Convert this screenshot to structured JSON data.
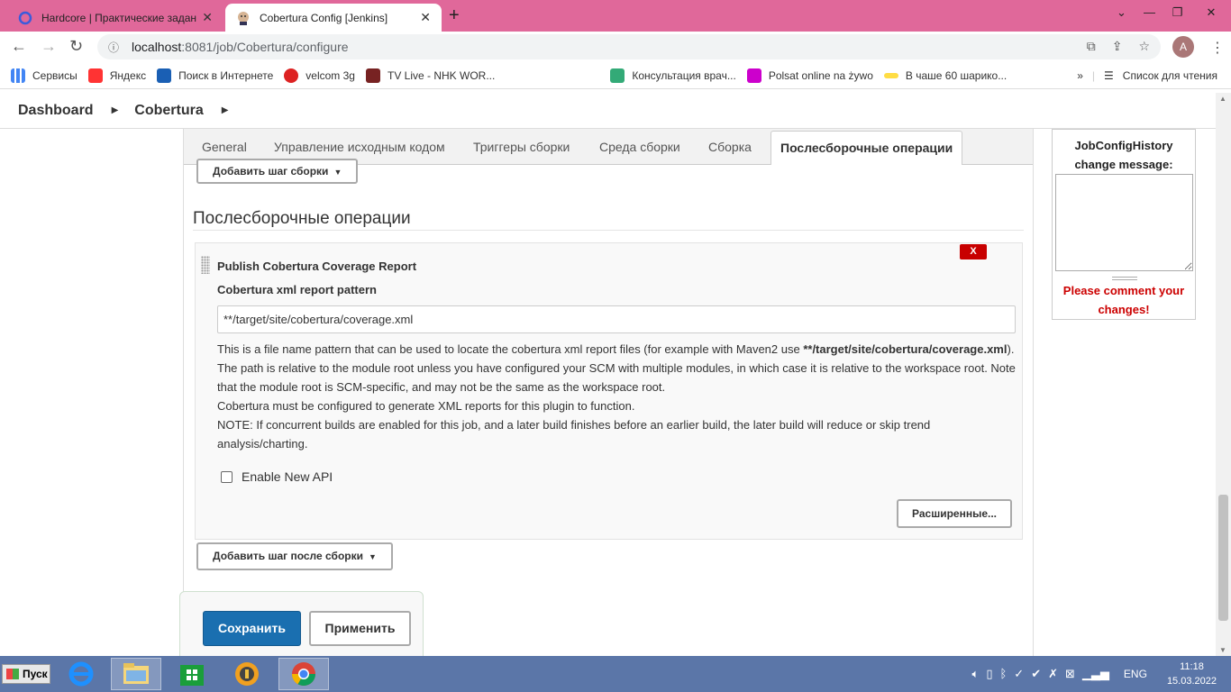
{
  "browser": {
    "tabs": [
      {
        "title": "Hardcore | Практические задани"
      },
      {
        "title": "Cobertura Config [Jenkins]"
      }
    ],
    "new_tab": "+",
    "url_host": "localhost",
    "url_path": ":8081/job/Cobertura/configure",
    "avatar_letter": "A"
  },
  "bookmarks": {
    "items": [
      {
        "label": "Сервисы"
      },
      {
        "label": "Яндекс"
      },
      {
        "label": "Поиск в Интернете"
      },
      {
        "label": "velcom 3g"
      },
      {
        "label": "TV Live - NHK WOR..."
      },
      {
        "label": "Консультация врач..."
      },
      {
        "label": "Polsat online na żywo"
      },
      {
        "label": "В чаше 60 шарико..."
      }
    ],
    "reading_list": "Список для чтения",
    "more": "»"
  },
  "breadcrumb": {
    "items": [
      "Dashboard",
      "Cobertura"
    ]
  },
  "config": {
    "tabs": [
      "General",
      "Управление исходным кодом",
      "Триггеры сборки",
      "Среда сборки",
      "Сборка",
      "Послесборочные операции"
    ],
    "add_build_step": "Добавить шаг сборки",
    "section_title": "Послесборочные операции",
    "plugin": {
      "delete_label": "X",
      "title": "Publish Cobertura Coverage Report",
      "field_label": "Cobertura xml report pattern",
      "field_value": "**/target/site/cobertura/coverage.xml",
      "help_part1": "This is a file name pattern that can be used to locate the cobertura xml report files (for example with Maven2 use ",
      "help_bold": "**/target/site/cobertura/coverage.xml",
      "help_part2": "). The path is relative to the module root unless you have configured your SCM with multiple modules, in which case it is relative to the workspace root. Note that the module root is SCM-specific, and may not be the same as the workspace root.",
      "help_line2": "Cobertura must be configured to generate XML reports for this plugin to function.",
      "help_line3": "NOTE: If concurrent builds are enabled for this job, and a later build finishes before an earlier build, the later build will reduce or skip trend analysis/charting.",
      "checkbox_label": "Enable New API",
      "checkbox_checked": false,
      "advanced_label": "Расширенные..."
    },
    "add_post_build_step": "Добавить шаг после сборки",
    "save_label": "Сохранить",
    "apply_label": "Применить"
  },
  "history_panel": {
    "title_line1": "JobConfigHistory",
    "title_line2": "change message:",
    "warning_line1": "Please comment your",
    "warning_line2": "changes!"
  },
  "taskbar": {
    "start_label": "Пуск",
    "lang": "ENG",
    "time": "11:18",
    "date": "15.03.2022"
  }
}
